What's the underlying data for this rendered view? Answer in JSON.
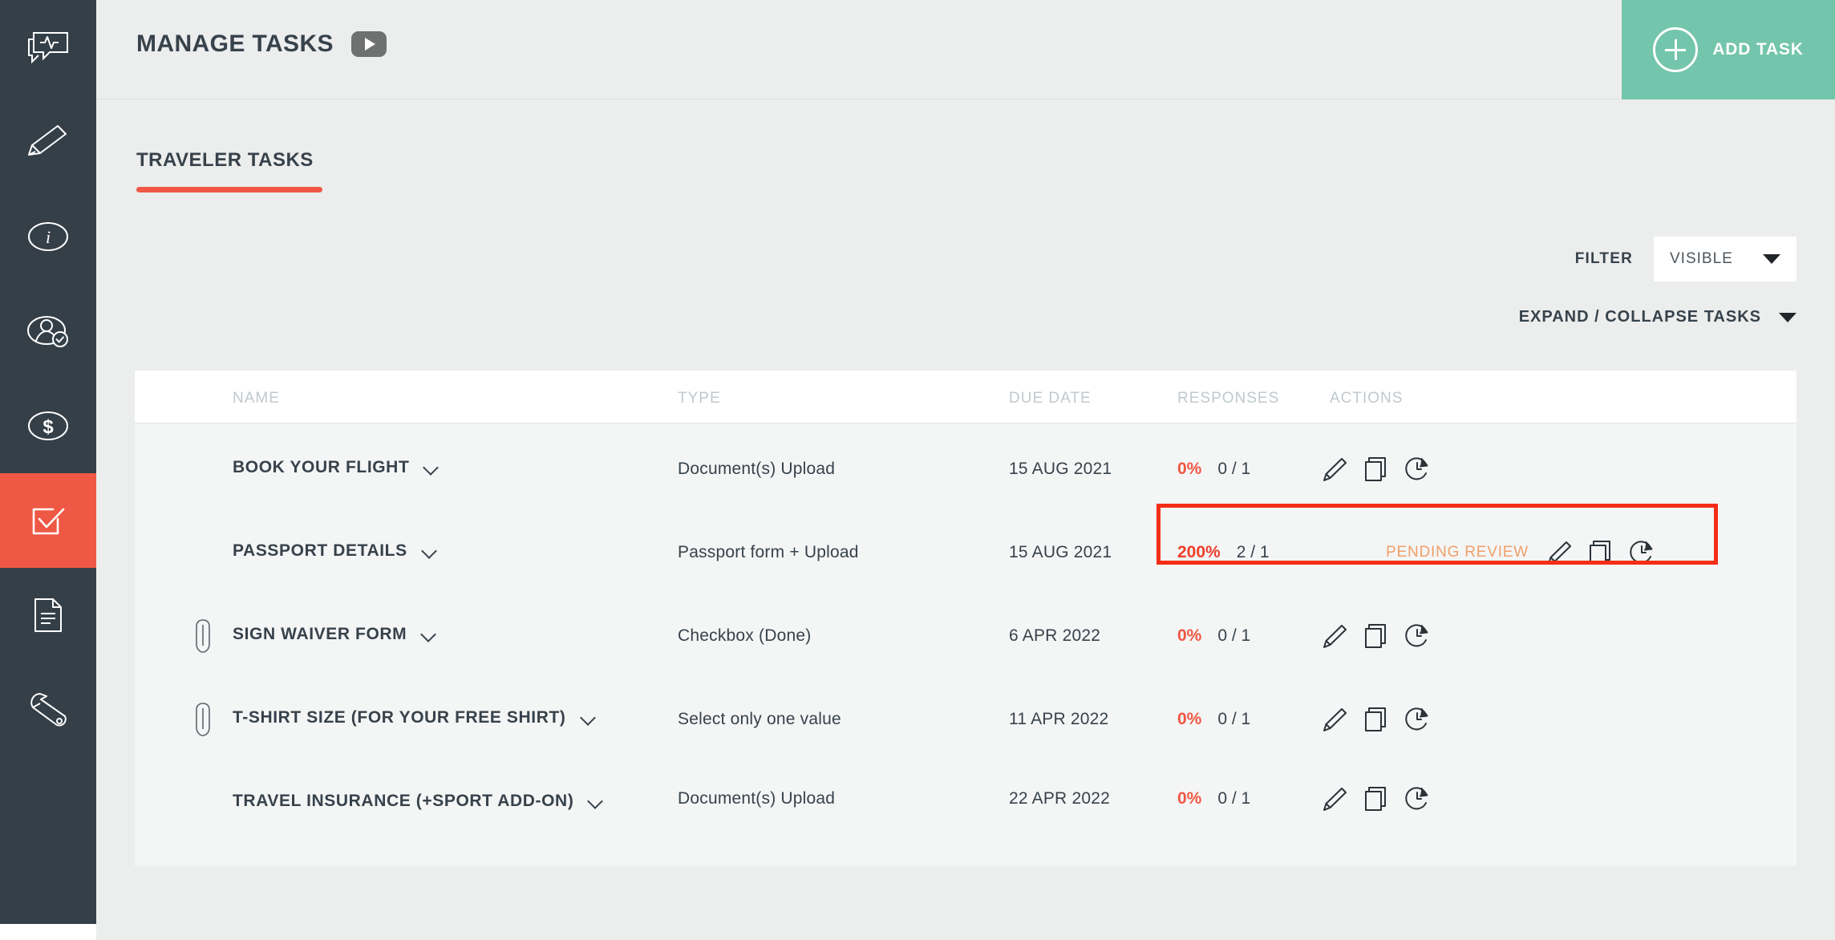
{
  "sidebar": {
    "items": [
      {
        "name": "messages-icon",
        "label": "Messages",
        "active": false
      },
      {
        "name": "edit-icon",
        "label": "Edit",
        "active": false
      },
      {
        "name": "info-icon",
        "label": "Info",
        "active": false
      },
      {
        "name": "traveler-icon",
        "label": "Travelers",
        "active": false
      },
      {
        "name": "payments-icon",
        "label": "Payments",
        "active": false
      },
      {
        "name": "tasks-icon",
        "label": "Tasks",
        "active": true
      },
      {
        "name": "documents-icon",
        "label": "Documents",
        "active": false
      },
      {
        "name": "settings-wrench-icon",
        "label": "Settings",
        "active": false
      }
    ]
  },
  "header": {
    "title": "MANAGE TASKS",
    "video_icon": "play-icon",
    "add_task_label": "ADD TASK",
    "add_task_icon": "plus-circle-icon"
  },
  "tabs": [
    {
      "label": "TRAVELER TASKS",
      "active": true
    }
  ],
  "controls": {
    "filter_label": "FILTER",
    "filter_value": "VISIBLE",
    "filter_caret": "chevron-down-icon",
    "expand_collapse_label": "EXPAND / COLLAPSE TASKS",
    "expand_caret": "chevron-down-icon"
  },
  "table": {
    "columns": [
      "NAME",
      "TYPE",
      "DUE DATE",
      "RESPONSES",
      "ACTIONS"
    ],
    "rows": [
      {
        "attachment": false,
        "name": "BOOK YOUR FLIGHT",
        "type": "Document(s) Upload",
        "due_date": "15 AUG 2021",
        "percent": "0%",
        "fraction": "0 / 1",
        "status": "",
        "highlighted": false,
        "actions": [
          "pencil-icon",
          "copy-icon",
          "clock-reminder-icon"
        ]
      },
      {
        "attachment": false,
        "name": "PASSPORT DETAILS",
        "type": "Passport form + Upload",
        "due_date": "15 AUG 2021",
        "percent": "200%",
        "fraction": "2 / 1",
        "status": "PENDING REVIEW",
        "highlighted": true,
        "actions": [
          "pencil-icon",
          "copy-icon",
          "clock-reminder-icon"
        ]
      },
      {
        "attachment": true,
        "name": "SIGN WAIVER FORM",
        "type": "Checkbox (Done)",
        "due_date": "6 APR 2022",
        "percent": "0%",
        "fraction": "0 / 1",
        "status": "",
        "highlighted": false,
        "actions": [
          "pencil-icon",
          "copy-icon",
          "clock-reminder-icon"
        ]
      },
      {
        "attachment": true,
        "name": "T-SHIRT SIZE (FOR YOUR FREE SHIRT)",
        "type": "Select only one value",
        "due_date": "11 APR 2022",
        "percent": "0%",
        "fraction": "0 / 1",
        "status": "",
        "highlighted": false,
        "actions": [
          "pencil-icon",
          "copy-icon",
          "clock-reminder-icon"
        ]
      },
      {
        "attachment": false,
        "name": "TRAVEL INSURANCE (+SPORT ADD-ON)",
        "type": "Document(s) Upload",
        "due_date": "22 APR 2022",
        "percent": "0%",
        "fraction": "0 / 1",
        "status": "",
        "highlighted": false,
        "actions": [
          "pencil-icon",
          "copy-icon",
          "clock-reminder-icon"
        ]
      }
    ]
  },
  "colors": {
    "sidebar_bg": "#343f48",
    "accent_red": "#ef5844",
    "highlight_border": "#f42e16",
    "add_task_green": "#73c5ab",
    "pending_orange": "#f0a06a",
    "page_bg": "#eceded",
    "card_bg": "#f4f5f5",
    "header_text": "#37424b",
    "column_header": "#c0c9ce"
  }
}
